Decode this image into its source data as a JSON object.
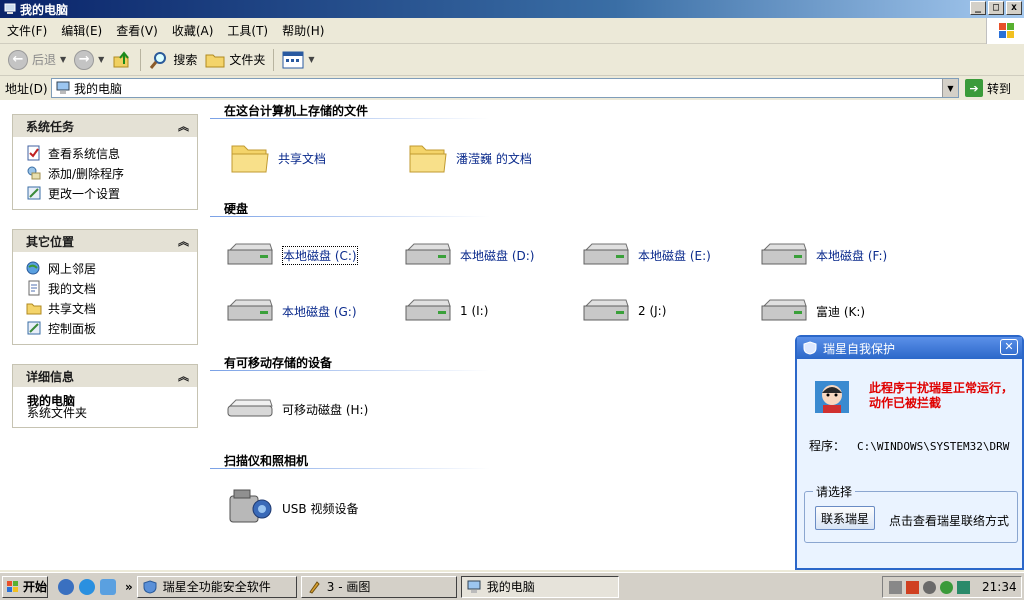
{
  "window": {
    "title": "我的电脑"
  },
  "menu": [
    "文件(F)",
    "编辑(E)",
    "查看(V)",
    "收藏(A)",
    "工具(T)",
    "帮助(H)"
  ],
  "toolbar": {
    "back": "后退",
    "search": "搜索",
    "folders": "文件夹"
  },
  "address": {
    "label": "地址(D)",
    "value": "我的电脑",
    "go": "转到"
  },
  "panels": {
    "tasks": {
      "title": "系统任务",
      "items": [
        "查看系统信息",
        "添加/删除程序",
        "更改一个设置"
      ]
    },
    "places": {
      "title": "其它位置",
      "items": [
        "网上邻居",
        "我的文档",
        "共享文档",
        "控制面板"
      ]
    },
    "details": {
      "title": "详细信息",
      "name": "我的电脑",
      "type": "系统文件夹"
    }
  },
  "sections": {
    "files": {
      "title": "在这台计算机上存储的文件",
      "items": [
        "共享文档",
        "潘滢巍 的文档"
      ]
    },
    "drives": {
      "title": "硬盘",
      "items": [
        "本地磁盘 (C:)",
        "本地磁盘 (D:)",
        "本地磁盘 (E:)",
        "本地磁盘 (F:)",
        "本地磁盘 (G:)",
        "1 (I:)",
        "2 (J:)",
        "富迪 (K:)"
      ]
    },
    "removable": {
      "title": "有可移动存储的设备",
      "items": [
        "可移动磁盘 (H:)"
      ]
    },
    "scanners": {
      "title": "扫描仪和照相机",
      "items": [
        "USB 视频设备"
      ]
    }
  },
  "popup": {
    "title": "瑞星自我保护",
    "message": "此程序干扰瑞星正常运行，动作已被拦截",
    "program_label": "程序：",
    "program_path": "C:\\WINDOWS\\SYSTEM32\\DRW",
    "group_label": "请选择",
    "contact_button": "联系瑞星",
    "contact_desc": "点击查看瑞星联络方式"
  },
  "taskbar": {
    "start": "开始",
    "tasks": [
      "瑞星全功能安全软件",
      "3 - 画图",
      "我的电脑"
    ],
    "clock": "21:34"
  },
  "colors": {
    "link": "#0a2a8c",
    "popup_alert": "#e00000",
    "title_bar": "#0a246a"
  }
}
